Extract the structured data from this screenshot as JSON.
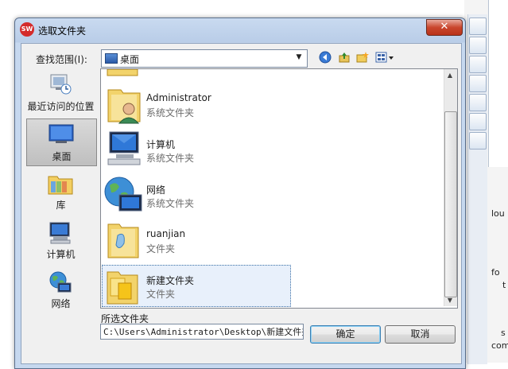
{
  "dialog": {
    "title": "选取文件夹",
    "close_label": "✕",
    "app_badge": "SW"
  },
  "lookin": {
    "label": "查找范围(I):",
    "value": "桌面",
    "arrow": "▼"
  },
  "toolbar": {
    "back": "◀",
    "up": "⬆",
    "new_folder": "✚",
    "view": "▦▾"
  },
  "places": [
    {
      "label": "最近访问的位置"
    },
    {
      "label": "桌面"
    },
    {
      "label": "库"
    },
    {
      "label": "计算机"
    },
    {
      "label": "网络"
    }
  ],
  "files": [
    {
      "name": "Administrator",
      "type": "系统文件夹"
    },
    {
      "name": "计算机",
      "type": "系统文件夹"
    },
    {
      "name": "网络",
      "type": "系统文件夹"
    },
    {
      "name": "ruanjian",
      "type": "文件夹"
    },
    {
      "name": "新建文件夹",
      "type": "文件夹"
    }
  ],
  "scrollbar": {
    "up": "▲",
    "down": "▼"
  },
  "selection": {
    "label": "所选文件夹",
    "path": "C:\\Users\\Administrator\\Desktop\\新建文件夹"
  },
  "buttons": {
    "ok": "确定",
    "cancel": "取消"
  },
  "background_app": {
    "lines": [
      "lou",
      "fo",
      "t",
      "s",
      "com"
    ]
  },
  "colors": {
    "accent": "#3c7fb1",
    "title_bar": "#b9cde8",
    "close": "#c9462d"
  }
}
